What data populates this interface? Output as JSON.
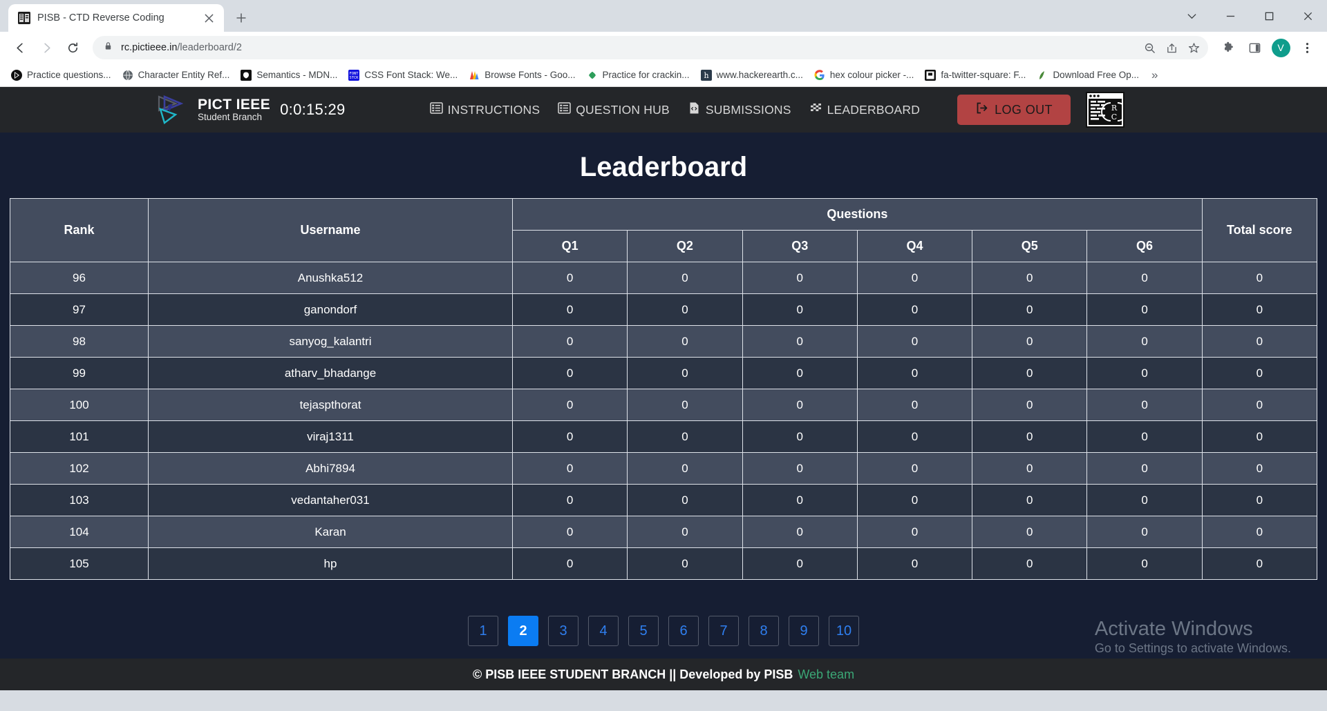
{
  "browser": {
    "tab": {
      "title": "PISB - CTD Reverse Coding",
      "favicon": "pisb-favicon"
    },
    "new_tab_label": "+",
    "window_controls": [
      "minimize-to-tray",
      "minimize",
      "maximize",
      "close"
    ],
    "omnibox": {
      "host": "rc.pictieee.in",
      "path": "/leaderboard/2",
      "full_url": "rc.pictieee.in/leaderboard/2",
      "lock_icon": "lock-icon"
    },
    "toolbar_icons": [
      "back-icon",
      "forward-icon",
      "reload-icon",
      "zoom-out-icon",
      "share-icon",
      "bookmark-star-icon",
      "extensions-icon",
      "side-panel-icon",
      "menu-icon"
    ],
    "profile_initial": "V",
    "bookmarks": [
      {
        "label": "Practice questions...",
        "icon": "practice-icon"
      },
      {
        "label": "Character Entity Ref...",
        "icon": "globe-icon"
      },
      {
        "label": "Semantics - MDN...",
        "icon": "mdn-icon"
      },
      {
        "label": "CSS Font Stack: We...",
        "icon": "fontstack-icon"
      },
      {
        "label": "Browse Fonts - Goo...",
        "icon": "google-fonts-icon"
      },
      {
        "label": "Practice for crackin...",
        "icon": "leetcode-icon"
      },
      {
        "label": "www.hackerearth.c...",
        "icon": "hackerearth-icon"
      },
      {
        "label": "hex colour picker -...",
        "icon": "google-icon"
      },
      {
        "label": "fa-twitter-square: F...",
        "icon": "fontawesome-icon"
      },
      {
        "label": "Download Free Op...",
        "icon": "fontsquirrel-icon"
      }
    ],
    "bookmarks_overflow": "»"
  },
  "site": {
    "brand": {
      "line1": "PICT IEEE",
      "line2": "Student Branch",
      "logo_icon": "pict-ieee-logo-icon"
    },
    "timer": "0:0:15:29",
    "nav": [
      {
        "label": "INSTRUCTIONS",
        "icon": "list-alt-icon"
      },
      {
        "label": "QUESTION HUB",
        "icon": "list-alt-icon"
      },
      {
        "label": "SUBMISSIONS",
        "icon": "file-code-icon"
      },
      {
        "label": "LEADERBOARD",
        "icon": "flag-checkered-icon"
      }
    ],
    "logout": {
      "label": "LOG OUT",
      "icon": "sign-out-icon",
      "color": "#b24343"
    },
    "rc_logo_icon": "reverse-coding-logo-icon",
    "page_title": "Leaderboard"
  },
  "table": {
    "headers": {
      "rank": "Rank",
      "username": "Username",
      "questions": "Questions",
      "total": "Total score"
    },
    "question_columns": [
      "Q1",
      "Q2",
      "Q3",
      "Q4",
      "Q5",
      "Q6"
    ],
    "rows": [
      {
        "rank": "96",
        "username": "Anushka512",
        "scores": [
          "0",
          "0",
          "0",
          "0",
          "0",
          "0"
        ],
        "total": "0"
      },
      {
        "rank": "97",
        "username": "ganondorf",
        "scores": [
          "0",
          "0",
          "0",
          "0",
          "0",
          "0"
        ],
        "total": "0"
      },
      {
        "rank": "98",
        "username": "sanyog_kalantri",
        "scores": [
          "0",
          "0",
          "0",
          "0",
          "0",
          "0"
        ],
        "total": "0"
      },
      {
        "rank": "99",
        "username": "atharv_bhadange",
        "scores": [
          "0",
          "0",
          "0",
          "0",
          "0",
          "0"
        ],
        "total": "0"
      },
      {
        "rank": "100",
        "username": "tejaspthorat",
        "scores": [
          "0",
          "0",
          "0",
          "0",
          "0",
          "0"
        ],
        "total": "0"
      },
      {
        "rank": "101",
        "username": "viraj1311",
        "scores": [
          "0",
          "0",
          "0",
          "0",
          "0",
          "0"
        ],
        "total": "0"
      },
      {
        "rank": "102",
        "username": "Abhi7894",
        "scores": [
          "0",
          "0",
          "0",
          "0",
          "0",
          "0"
        ],
        "total": "0"
      },
      {
        "rank": "103",
        "username": "vedantaher031",
        "scores": [
          "0",
          "0",
          "0",
          "0",
          "0",
          "0"
        ],
        "total": "0"
      },
      {
        "rank": "104",
        "username": "Karan",
        "scores": [
          "0",
          "0",
          "0",
          "0",
          "0",
          "0"
        ],
        "total": "0"
      },
      {
        "rank": "105",
        "username": "hp",
        "scores": [
          "0",
          "0",
          "0",
          "0",
          "0",
          "0"
        ],
        "total": "0"
      }
    ]
  },
  "pagination": {
    "pages": [
      "1",
      "2",
      "3",
      "4",
      "5",
      "6",
      "7",
      "8",
      "9",
      "10"
    ],
    "active": "2",
    "active_color": "#0b7cf2"
  },
  "watermark": {
    "line1": "Activate Windows",
    "line2": "Go to Settings to activate Windows."
  },
  "footer": {
    "main": "© PISB IEEE STUDENT BRANCH || Developed by PISB",
    "link": "Web team",
    "link_color": "#3ba776"
  }
}
